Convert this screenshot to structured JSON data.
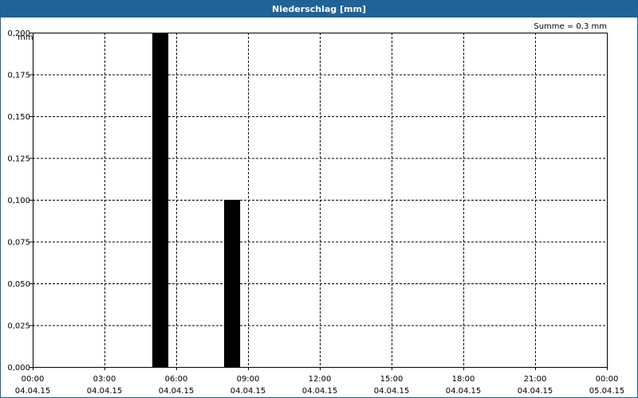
{
  "window": {
    "title": "Niederschlag [mm]"
  },
  "chart_data": {
    "type": "bar",
    "title": "Niederschlag [mm]",
    "ylabel": "mm",
    "annotation": "Summe = 0,3 mm",
    "ylim": [
      0,
      0.2
    ],
    "y_ticks": [
      {
        "value": 0.0,
        "label": "0,000"
      },
      {
        "value": 0.025,
        "label": "0,025"
      },
      {
        "value": 0.05,
        "label": "0,050"
      },
      {
        "value": 0.075,
        "label": "0,075"
      },
      {
        "value": 0.1,
        "label": "0,100"
      },
      {
        "value": 0.125,
        "label": "0,125"
      },
      {
        "value": 0.15,
        "label": "0,150"
      },
      {
        "value": 0.175,
        "label": "0,175"
      },
      {
        "value": 0.2,
        "label": "0,200"
      }
    ],
    "xlim_hours": [
      0,
      24
    ],
    "x_ticks": [
      {
        "hour": 0,
        "time": "00:00",
        "date": "04.04.15"
      },
      {
        "hour": 3,
        "time": "03:00",
        "date": "04.04.15"
      },
      {
        "hour": 6,
        "time": "06:00",
        "date": "04.04.15"
      },
      {
        "hour": 9,
        "time": "09:00",
        "date": "04.04.15"
      },
      {
        "hour": 12,
        "time": "12:00",
        "date": "04.04.15"
      },
      {
        "hour": 15,
        "time": "15:00",
        "date": "04.04.15"
      },
      {
        "hour": 18,
        "time": "18:00",
        "date": "04.04.15"
      },
      {
        "hour": 21,
        "time": "21:00",
        "date": "04.04.15"
      },
      {
        "hour": 24,
        "time": "00:00",
        "date": "05.04.15"
      }
    ],
    "bars": [
      {
        "start_hour": 5.0,
        "end_hour": 5.67,
        "value": 0.2
      },
      {
        "start_hour": 8.0,
        "end_hour": 8.67,
        "value": 0.1
      }
    ],
    "bar_color": "#000000",
    "grid": true
  }
}
